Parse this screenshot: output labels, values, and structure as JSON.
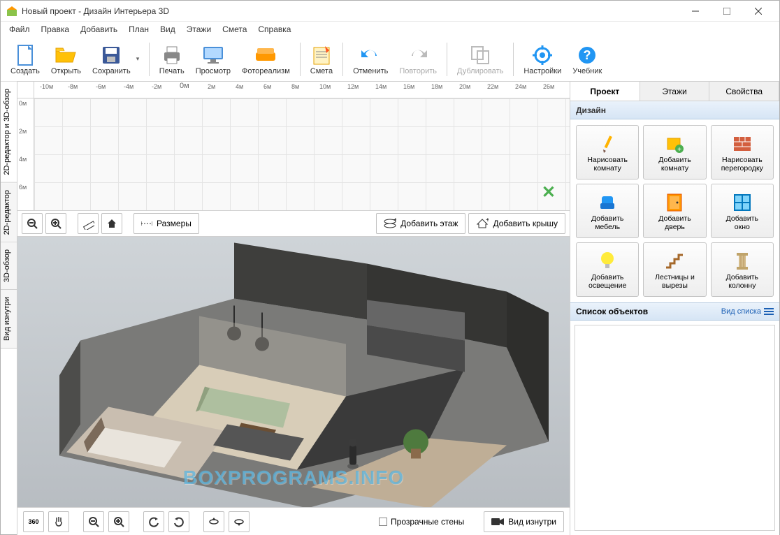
{
  "window": {
    "title": "Новый проект - Дизайн Интерьера 3D"
  },
  "menu": [
    "Файл",
    "Правка",
    "Добавить",
    "План",
    "Вид",
    "Этажи",
    "Смета",
    "Справка"
  ],
  "toolbar": [
    {
      "id": "create",
      "label": "Создать"
    },
    {
      "id": "open",
      "label": "Открыть"
    },
    {
      "id": "save",
      "label": "Сохранить"
    },
    {
      "sep": true
    },
    {
      "id": "print",
      "label": "Печать"
    },
    {
      "id": "preview",
      "label": "Просмотр"
    },
    {
      "id": "photoreal",
      "label": "Фотореализм"
    },
    {
      "sep": true
    },
    {
      "id": "estimate",
      "label": "Смета"
    },
    {
      "sep": true
    },
    {
      "id": "undo",
      "label": "Отменить"
    },
    {
      "id": "redo",
      "label": "Повторить",
      "disabled": true
    },
    {
      "sep": true
    },
    {
      "id": "duplicate",
      "label": "Дублировать",
      "disabled": true
    },
    {
      "sep": true
    },
    {
      "id": "settings",
      "label": "Настройки"
    },
    {
      "id": "tutorial",
      "label": "Учебник"
    }
  ],
  "left_tabs": [
    {
      "label": "2D-редактор и 3D-обзор",
      "active": true
    },
    {
      "label": "2D-редактор"
    },
    {
      "label": "3D-обзор"
    },
    {
      "label": "Вид изнутри"
    }
  ],
  "ruler_h": [
    "-10м",
    "-8м",
    "-6м",
    "-4м",
    "-2м",
    "0м",
    "2м",
    "4м",
    "6м",
    "8м",
    "10м",
    "12м",
    "14м",
    "16м",
    "18м",
    "20м",
    "22м",
    "24м",
    "26м"
  ],
  "ruler_v": [
    "0м",
    "2м",
    "4м",
    "6м"
  ],
  "canvas_toolbar": {
    "dimensions": "Размеры",
    "add_floor": "Добавить этаж",
    "add_roof": "Добавить крышу"
  },
  "bottom": {
    "transparent_walls": "Прозрачные стены",
    "inside_view": "Вид изнутри"
  },
  "side": {
    "tabs": [
      "Проект",
      "Этажи",
      "Свойства"
    ],
    "design_hdr": "Дизайн",
    "tools": [
      {
        "id": "draw-room",
        "l1": "Нарисовать",
        "l2": "комнату"
      },
      {
        "id": "add-room",
        "l1": "Добавить",
        "l2": "комнату"
      },
      {
        "id": "draw-partition",
        "l1": "Нарисовать",
        "l2": "перегородку"
      },
      {
        "id": "add-furniture",
        "l1": "Добавить",
        "l2": "мебель"
      },
      {
        "id": "add-door",
        "l1": "Добавить",
        "l2": "дверь"
      },
      {
        "id": "add-window",
        "l1": "Добавить",
        "l2": "окно"
      },
      {
        "id": "add-light",
        "l1": "Добавить",
        "l2": "освещение"
      },
      {
        "id": "stairs",
        "l1": "Лестницы и",
        "l2": "вырезы"
      },
      {
        "id": "add-column",
        "l1": "Добавить",
        "l2": "колонну"
      }
    ],
    "objects_hdr": "Список объектов",
    "view_type": "Вид списка"
  },
  "watermark": "BOXPROGRAMS.INFO"
}
